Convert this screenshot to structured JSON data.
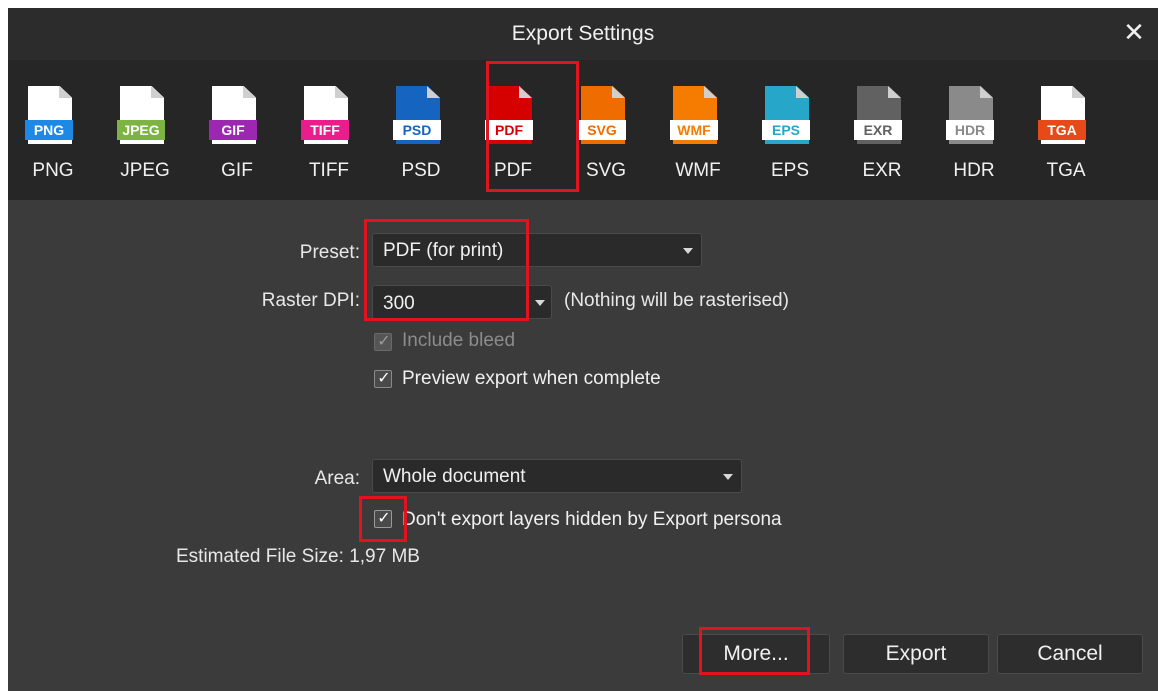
{
  "dialog": {
    "title": "Export Settings",
    "close_glyph": "✕"
  },
  "formats": [
    {
      "tag": "PNG",
      "label": "PNG",
      "color": "#1e88e5",
      "text_color": "#ffffff",
      "icon": "png-file-icon"
    },
    {
      "tag": "JPEG",
      "label": "JPEG",
      "color": "#7cb342",
      "text_color": "#ffffff",
      "icon": "jpeg-file-icon"
    },
    {
      "tag": "GIF",
      "label": "GIF",
      "color": "#9c27b0",
      "text_color": "#ffffff",
      "icon": "gif-file-icon"
    },
    {
      "tag": "TIFF",
      "label": "TIFF",
      "color": "#e91e8c",
      "text_color": "#ffffff",
      "icon": "tiff-file-icon"
    },
    {
      "tag": "PSD",
      "label": "PSD",
      "color": "#1565c0",
      "text_color": "#ffffff",
      "icon": "psd-file-icon"
    },
    {
      "tag": "PDF",
      "label": "PDF",
      "color": "#d50000",
      "text_color": "#ffffff",
      "icon": "pdf-file-icon",
      "selected": true
    },
    {
      "tag": "SVG",
      "label": "SVG",
      "color": "#ef6c00",
      "text_color": "#ffffff",
      "icon": "svg-file-icon"
    },
    {
      "tag": "WMF",
      "label": "WMF",
      "color": "#f57c00",
      "text_color": "#ffffff",
      "icon": "wmf-file-icon"
    },
    {
      "tag": "EPS",
      "label": "EPS",
      "color": "#26a6c9",
      "text_color": "#ffffff",
      "icon": "eps-file-icon"
    },
    {
      "tag": "EXR",
      "label": "EXR",
      "color": "#616161",
      "text_color": "#ffffff",
      "icon": "exr-file-icon"
    },
    {
      "tag": "HDR",
      "label": "HDR",
      "color": "#8a8a8a",
      "text_color": "#ffffff",
      "icon": "hdr-file-icon"
    },
    {
      "tag": "TGA",
      "label": "TGA",
      "color": "#e64a19",
      "text_color": "#ffffff",
      "icon": "tga-file-icon"
    }
  ],
  "form": {
    "preset_label": "Preset:",
    "preset_value": "PDF (for print)",
    "dpi_label": "Raster DPI:",
    "dpi_value": "300",
    "dpi_note": "(Nothing will be rasterised)",
    "include_bleed": {
      "label": "Include bleed",
      "checked": true,
      "disabled": true
    },
    "preview_export": {
      "label": "Preview export when complete",
      "checked": true
    },
    "area_label": "Area:",
    "area_value": "Whole document",
    "dont_export_hidden": {
      "label": "Don't export layers hidden by Export persona",
      "checked": true
    },
    "est_size_label": "Estimated File Size:",
    "est_size_value": "1,97 MB"
  },
  "buttons": {
    "more": "More...",
    "export": "Export",
    "cancel": "Cancel"
  },
  "colors": {
    "highlight": "#e0141e",
    "dialog_bg": "#3b3b3b",
    "title_bg": "#2c2c2c",
    "format_bar_bg": "#262626"
  }
}
